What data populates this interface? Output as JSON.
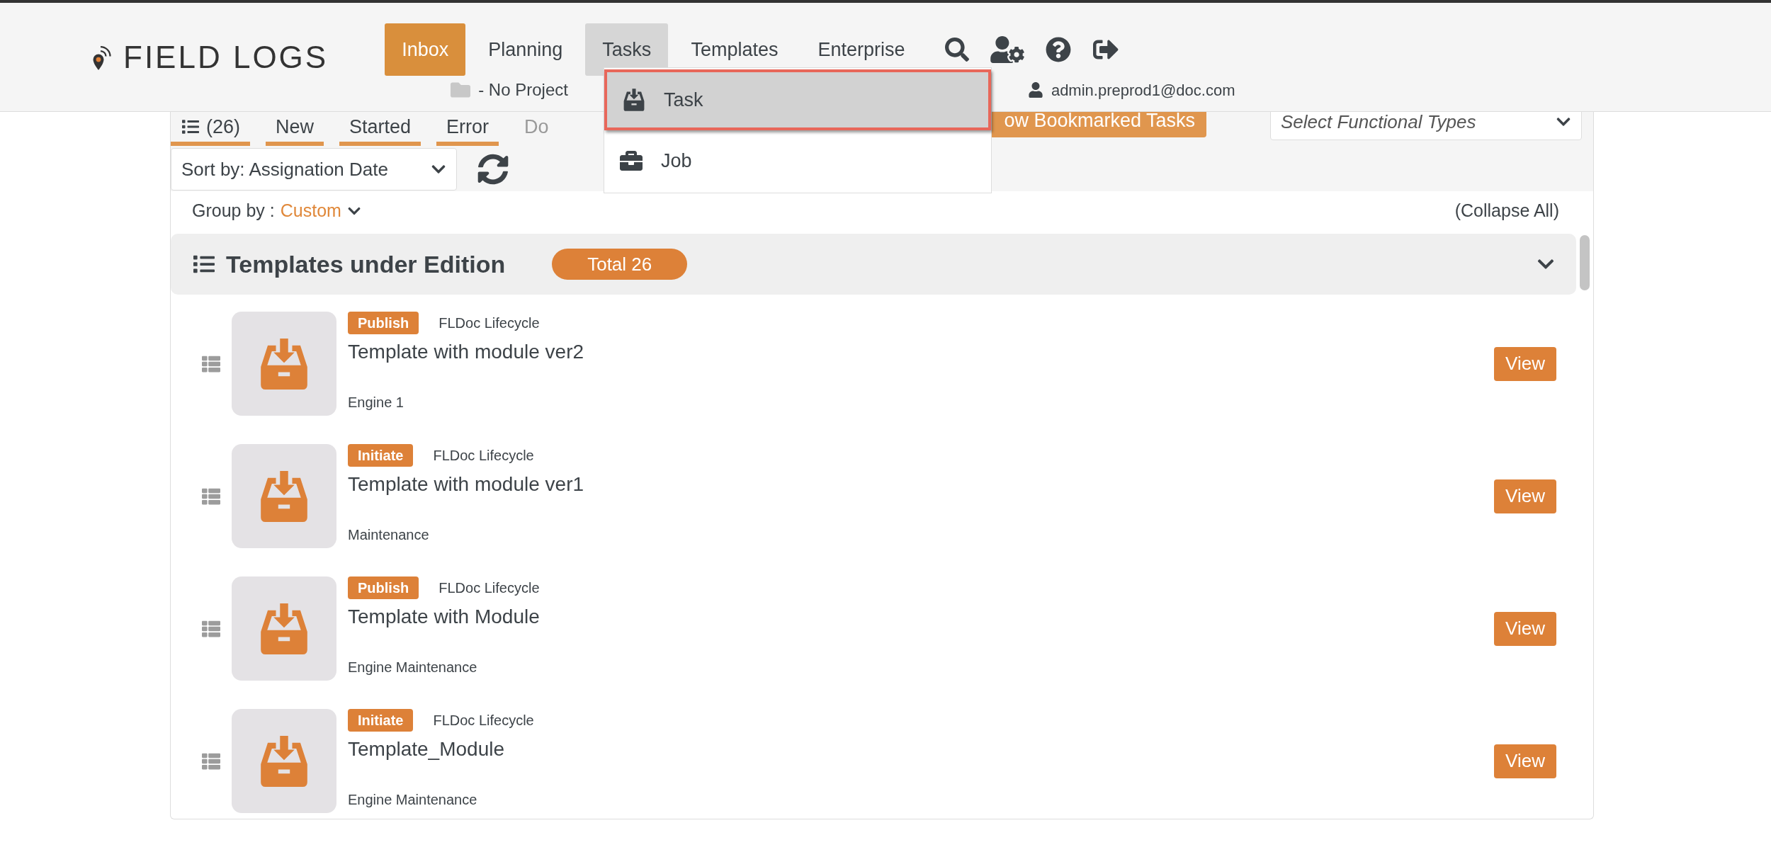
{
  "header": {
    "logo": "FIELD LOGS",
    "nav": [
      {
        "label": "Inbox",
        "selected": true,
        "open": false
      },
      {
        "label": "Planning",
        "selected": false,
        "open": false
      },
      {
        "label": "Tasks",
        "selected": false,
        "open": true
      },
      {
        "label": "Templates",
        "selected": false,
        "open": false
      },
      {
        "label": "Enterprise",
        "selected": false,
        "open": false
      }
    ],
    "project": "- No Project",
    "user": "admin.preprod1@doc.com"
  },
  "tasks_menu": {
    "items": [
      {
        "label": "Task",
        "kind": "task",
        "highlighted": true
      },
      {
        "label": "Job",
        "kind": "job",
        "highlighted": false
      }
    ]
  },
  "filter_tabs": [
    {
      "label": "(26)",
      "kind": "count",
      "on": true
    },
    {
      "label": "New",
      "kind": "status",
      "on": true
    },
    {
      "label": "Started",
      "kind": "status",
      "on": true
    },
    {
      "label": "Error",
      "kind": "status",
      "on": true
    },
    {
      "label": "Do",
      "kind": "status",
      "on": false
    }
  ],
  "bookmark_button": "ow Bookmarked Tasks",
  "functional_types": {
    "placeholder": "Select Functional Types"
  },
  "sort": {
    "value": "Sort by: Assignation Date"
  },
  "group_by": {
    "label": "Group by :",
    "value": "Custom"
  },
  "collapse_all": "(Collapse All)",
  "group": {
    "title": "Templates under Edition",
    "total": "Total 26",
    "expanded": true,
    "rows": [
      {
        "stage": "Publish",
        "lifecycle": "FLDoc Lifecycle",
        "title": "Template with module ver2",
        "subtitle": "Engine 1",
        "action": "View"
      },
      {
        "stage": "Initiate",
        "lifecycle": "FLDoc Lifecycle",
        "title": "Template with module ver1",
        "subtitle": "Maintenance",
        "action": "View"
      },
      {
        "stage": "Publish",
        "lifecycle": "FLDoc Lifecycle",
        "title": "Template with Module",
        "subtitle": "Engine Maintenance",
        "action": "View"
      },
      {
        "stage": "Initiate",
        "lifecycle": "FLDoc Lifecycle",
        "title": "Template_Module",
        "subtitle": "Engine Maintenance",
        "action": "View"
      }
    ]
  }
}
